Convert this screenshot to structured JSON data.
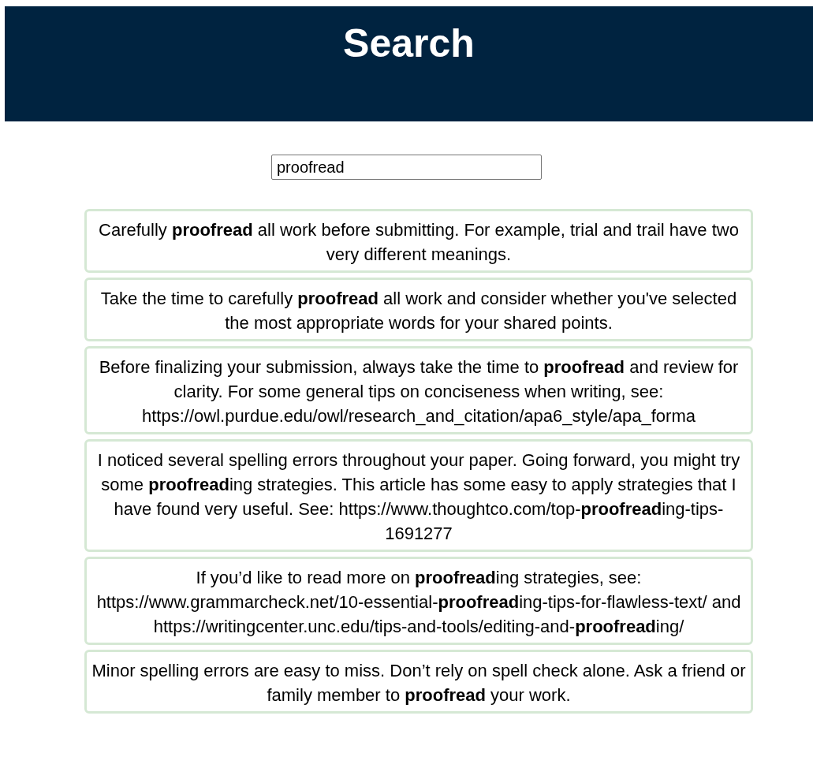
{
  "header": {
    "title": "Search"
  },
  "search": {
    "value": "proofread"
  },
  "results": [
    {
      "text": "Carefully **proofread** all work before submitting. For example, trial and trail have two very different meanings."
    },
    {
      "text": "Take the time to carefully **proofread** all work and consider whether you've selected the most appropriate words for your shared points."
    },
    {
      "text": "Before finalizing your submission, always take the time to **proofread** and review for clarity. For some general tips on conciseness when writing, see: https://owl.purdue.edu/owl/research_and_citation/apa6_style/apa_forma"
    },
    {
      "text": "I noticed several spelling errors throughout your paper. Going forward, you might try some **proofread**ing strategies. This article has some easy to apply strategies that I have found very useful. See: https://www.thoughtco.com/top-**proofread**ing-tips-1691277"
    },
    {
      "text": "If you’d like to read more on **proofread**ing strategies, see: https://www.grammarcheck.net/10-essential-**proofread**ing-tips-for-flawless-text/ and https://writingcenter.unc.edu/tips-and-tools/editing-and-**proofread**ing/"
    },
    {
      "text": "Minor spelling errors are easy to miss. Don’t rely on spell check alone. Ask a friend or family member to **proofread** your work."
    }
  ]
}
